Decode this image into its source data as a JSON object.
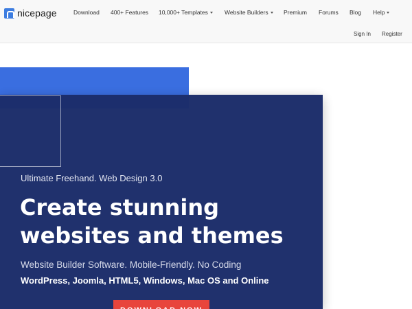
{
  "header": {
    "logo_text": "nicepage",
    "nav": {
      "download": "Download",
      "features": "400+ Features",
      "templates": "10,000+ Templates",
      "website_builders": "Website Builders",
      "premium": "Premium",
      "forums": "Forums",
      "blog": "Blog",
      "help": "Help"
    },
    "auth": {
      "sign_in": "Sign In",
      "register": "Register"
    }
  },
  "hero": {
    "eyebrow": "Ultimate Freehand. Web Design 3.0",
    "headline": "Create stunning websites and themes",
    "subline": "Website Builder Software. Mobile-Friendly. No Coding",
    "platforms": "WordPress, Joomla, HTML5, Windows, Mac OS and Online",
    "cta_label": "DOWNLOAD NOW"
  },
  "colors": {
    "header_bg": "#f8f8f8",
    "accent_blue": "#3a6ee0",
    "hero_panel": "#1c2d6b",
    "cta": "#e8453c"
  }
}
